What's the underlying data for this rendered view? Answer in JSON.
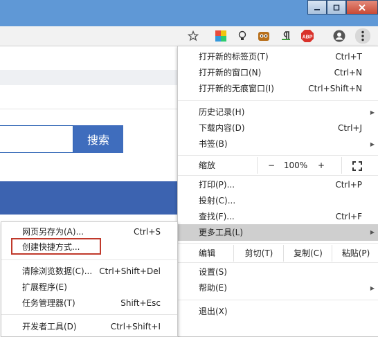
{
  "window": {
    "minimize": "minimize",
    "maximize": "maximize",
    "close": "close"
  },
  "toolbar": {
    "icons": [
      "star-icon",
      "colorful-extension-icon",
      "lightbulb-extension-icon",
      "owl-extension-icon",
      "pilcrow-extension-icon",
      "adblock-extension-icon",
      "profile-icon",
      "more-menu-icon"
    ],
    "abp_text": "ABP"
  },
  "page": {
    "search_button": "搜索"
  },
  "menu": {
    "new_tab": {
      "label": "打开新的标签页(T)",
      "shortcut": "Ctrl+T"
    },
    "new_window": {
      "label": "打开新的窗口(N)",
      "shortcut": "Ctrl+N"
    },
    "incognito": {
      "label": "打开新的无痕窗口(I)",
      "shortcut": "Ctrl+Shift+N"
    },
    "history": {
      "label": "历史记录(H)"
    },
    "downloads": {
      "label": "下载内容(D)",
      "shortcut": "Ctrl+J"
    },
    "bookmarks": {
      "label": "书签(B)"
    },
    "zoom": {
      "label": "缩放",
      "minus": "−",
      "value": "100%",
      "plus": "+"
    },
    "print": {
      "label": "打印(P)...",
      "shortcut": "Ctrl+P"
    },
    "cast": {
      "label": "投射(C)..."
    },
    "find": {
      "label": "查找(F)...",
      "shortcut": "Ctrl+F"
    },
    "more_tools": {
      "label": "更多工具(L)"
    },
    "edit": {
      "label": "编辑",
      "cut": "剪切(T)",
      "copy": "复制(C)",
      "paste": "粘贴(P)"
    },
    "settings": {
      "label": "设置(S)"
    },
    "help": {
      "label": "帮助(E)"
    },
    "exit": {
      "label": "退出(X)"
    }
  },
  "submenu": {
    "save_page": {
      "label": "网页另存为(A)...",
      "shortcut": "Ctrl+S"
    },
    "create_shortcut": {
      "label": "创建快捷方式..."
    },
    "clear_data": {
      "label": "清除浏览数据(C)...",
      "shortcut": "Ctrl+Shift+Del"
    },
    "extensions": {
      "label": "扩展程序(E)"
    },
    "task_manager": {
      "label": "任务管理器(T)",
      "shortcut": "Shift+Esc"
    },
    "dev_tools": {
      "label": "开发者工具(D)",
      "shortcut": "Ctrl+Shift+I"
    }
  },
  "colors": {
    "accent": "#3f6dbd",
    "highlight_box": "#c0392b",
    "titlebar": "#5f98d6"
  }
}
